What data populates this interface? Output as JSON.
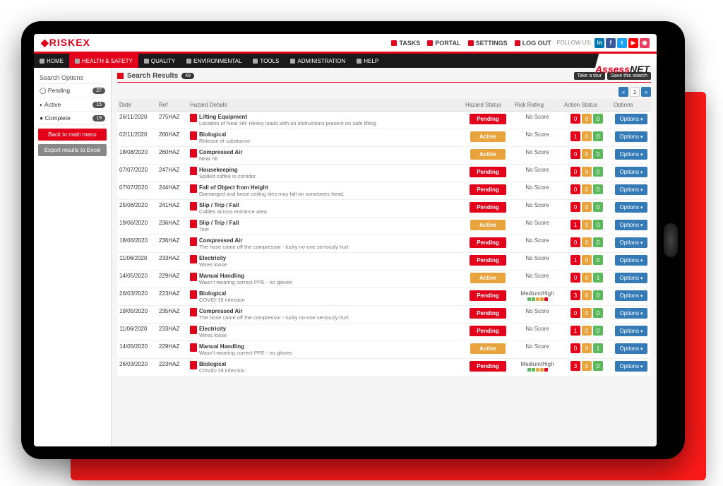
{
  "brand": "RISKEX",
  "brand2": {
    "a": "Assess",
    "n": "NET"
  },
  "topnav": [
    {
      "label": "TASKS"
    },
    {
      "label": "PORTAL"
    },
    {
      "label": "SETTINGS"
    },
    {
      "label": "LOG OUT"
    }
  ],
  "follow_label": "FOLLOW US:",
  "social": [
    {
      "bg": "#0077b5",
      "t": "in"
    },
    {
      "bg": "#3b5998",
      "t": "f"
    },
    {
      "bg": "#1da1f2",
      "t": "t"
    },
    {
      "bg": "#ff0000",
      "t": "▶"
    },
    {
      "bg": "#e4405f",
      "t": "◉"
    }
  ],
  "menubar": [
    {
      "label": "HOME",
      "active": false
    },
    {
      "label": "HEALTH & SAFETY",
      "active": true
    },
    {
      "label": "QUALITY",
      "active": false
    },
    {
      "label": "ENVIRONMENTAL",
      "active": false
    },
    {
      "label": "TOOLS",
      "active": false
    },
    {
      "label": "ADMINISTRATION",
      "active": false
    },
    {
      "label": "HELP",
      "active": false
    }
  ],
  "sidebar": {
    "title": "Search Options",
    "items": [
      {
        "label": "Pending",
        "count": "27"
      },
      {
        "label": "Active",
        "count": "15"
      },
      {
        "label": "Complete",
        "count": "19"
      }
    ],
    "back": "Back to main menu",
    "export": "Export results to Excel"
  },
  "results": {
    "title": "Search Results",
    "count": "49",
    "take_tour": "Take a tour",
    "save_search": "Save this search"
  },
  "pager": {
    "prev": "«",
    "page": "1",
    "next": "»"
  },
  "columns": [
    "Date",
    "Ref",
    "Hazard Details",
    "Hazard Status",
    "Risk Rating",
    "Action Status",
    "Options"
  ],
  "option_label": "Options",
  "action_colors": [
    "#e2001a",
    "#e8a33d",
    "#5cb85c"
  ],
  "rows": [
    {
      "date": "26/11/2020",
      "ref": "275HAZ",
      "title": "Lifting Equipment",
      "desc": "Location of Near Hit: Heavy loads with no instructions present on safe lifting",
      "status": "Pending",
      "risk": "No Score",
      "acts": [
        0,
        0,
        0
      ]
    },
    {
      "date": "02/11/2020",
      "ref": "260HAZ",
      "title": "Biological",
      "desc": "Release of substance",
      "status": "Active",
      "risk": "No Score",
      "acts": [
        1,
        0,
        0
      ]
    },
    {
      "date": "18/08/2020",
      "ref": "260HAZ",
      "title": "Compressed Air",
      "desc": "Near hit",
      "status": "Active",
      "risk": "No Score",
      "acts": [
        0,
        0,
        0
      ]
    },
    {
      "date": "07/07/2020",
      "ref": "247HAZ",
      "title": "Housekeeping",
      "desc": "Spilled coffee in corridor",
      "status": "Pending",
      "risk": "No Score",
      "acts": [
        0,
        0,
        0
      ]
    },
    {
      "date": "07/07/2020",
      "ref": "244HAZ",
      "title": "Fall of Object from Height",
      "desc": "Damanged and loose ceiling tiles may fall on someones head.",
      "status": "Pending",
      "risk": "No Score",
      "acts": [
        0,
        0,
        0
      ]
    },
    {
      "date": "25/06/2020",
      "ref": "241HAZ",
      "title": "Slip / Trip / Fall",
      "desc": "Cables across entrance area",
      "status": "Pending",
      "risk": "No Score",
      "acts": [
        0,
        0,
        0
      ]
    },
    {
      "date": "19/06/2020",
      "ref": "236HAZ",
      "title": "Slip / Trip / Fall",
      "desc": "Test",
      "status": "Active",
      "risk": "No Score",
      "acts": [
        1,
        0,
        0
      ]
    },
    {
      "date": "18/06/2020",
      "ref": "236HAZ",
      "title": "Compressed Air",
      "desc": "The hose came off the compressor - lucky no-one seriously hurt",
      "status": "Pending",
      "risk": "No Score",
      "acts": [
        0,
        0,
        0
      ]
    },
    {
      "date": "11/06/2020",
      "ref": "233HAZ",
      "title": "Electricity",
      "desc": "Wires loose",
      "status": "Pending",
      "risk": "No Score",
      "acts": [
        1,
        0,
        0
      ]
    },
    {
      "date": "14/05/2020",
      "ref": "229HAZ",
      "title": "Manual Handling",
      "desc": "Wasn't wearing correct PPE - no gloves",
      "status": "Active",
      "risk": "No Score",
      "acts": [
        0,
        0,
        1
      ]
    },
    {
      "date": "26/03/2020",
      "ref": "223HAZ",
      "title": "Biological",
      "desc": "COVID-19 infection",
      "status": "Pending",
      "risk": "Medium/High",
      "risk_dots": true,
      "acts": [
        3,
        0,
        0
      ]
    },
    {
      "date": "19/05/2020",
      "ref": "235HAZ",
      "title": "Compressed Air",
      "desc": "The hose came off the compressor - lucky no-one seriously hurt",
      "status": "Pending",
      "risk": "No Score",
      "acts": [
        0,
        0,
        0
      ]
    },
    {
      "date": "11/06/2020",
      "ref": "233HAZ",
      "title": "Electricity",
      "desc": "Wires loose",
      "status": "Pending",
      "risk": "No Score",
      "acts": [
        1,
        0,
        0
      ]
    },
    {
      "date": "14/05/2020",
      "ref": "229HAZ",
      "title": "Manual Handling",
      "desc": "Wasn't wearing correct PPE - no gloves",
      "status": "Active",
      "risk": "No Score",
      "acts": [
        0,
        0,
        1
      ]
    },
    {
      "date": "26/03/2020",
      "ref": "223HAZ",
      "title": "Biological",
      "desc": "COVID-19 infection",
      "status": "Pending",
      "risk": "Medium/High",
      "risk_dots": true,
      "acts": [
        3,
        0,
        0
      ]
    }
  ]
}
